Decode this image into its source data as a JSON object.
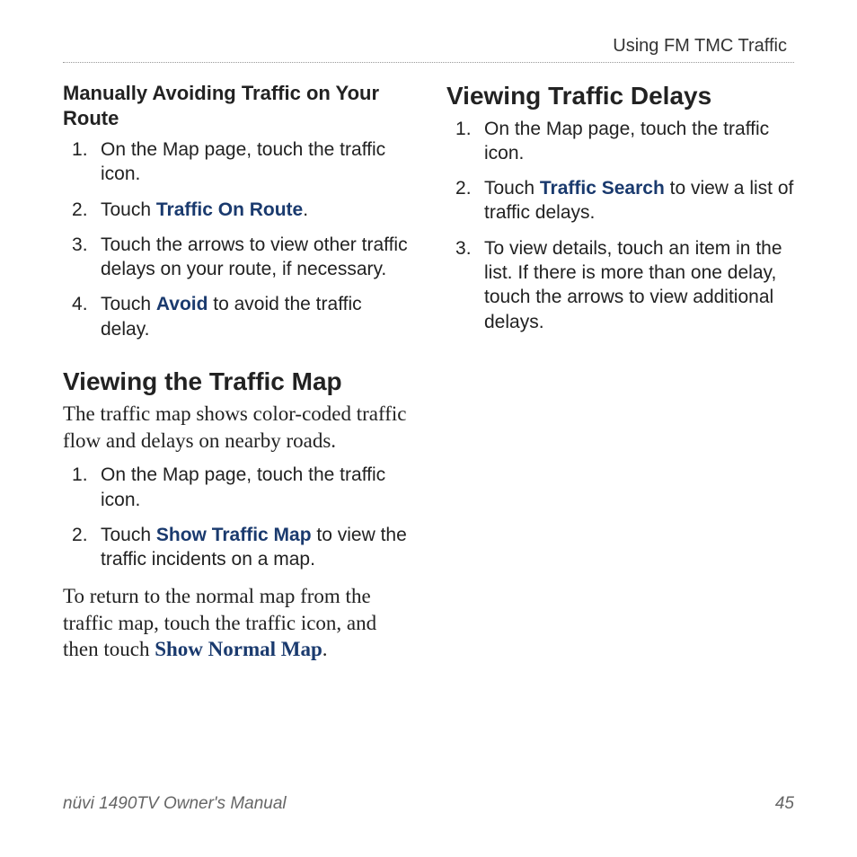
{
  "header": {
    "chapter": "Using FM TMC Traffic"
  },
  "left": {
    "sub1": {
      "title": "Manually Avoiding Traffic on Your Route"
    },
    "steps1": {
      "s1": "On the Map page, touch the traffic icon.",
      "s2a": "Touch ",
      "s2b": "Traffic On Route",
      "s2c": ".",
      "s3": "Touch the arrows to view other traffic delays on your route, if necessary.",
      "s4a": "Touch ",
      "s4b": "Avoid",
      "s4c": " to avoid the traffic delay."
    },
    "h2": "Viewing the Traffic Map",
    "p1": "The traffic map shows color-coded traffic flow and delays on nearby roads.",
    "steps2": {
      "s1": "On the Map page, touch the traffic icon.",
      "s2a": "Touch ",
      "s2b": "Show Traffic Map",
      "s2c": " to view the traffic incidents on a map."
    },
    "p2a": "To return to the normal map from the traffic map, touch the traffic icon, and then touch ",
    "p2b": "Show Normal Map",
    "p2c": "."
  },
  "right": {
    "h2": "Viewing Traffic Delays",
    "steps": {
      "s1": "On the Map page, touch the traffic icon.",
      "s2a": "Touch ",
      "s2b": "Traffic Search",
      "s2c": " to view a list of traffic delays.",
      "s3": "To view details, touch an item in the list. If there is more than one delay, touch the arrows to view additional delays."
    }
  },
  "footer": {
    "left": "nüvi 1490TV Owner's Manual",
    "right": "45"
  }
}
